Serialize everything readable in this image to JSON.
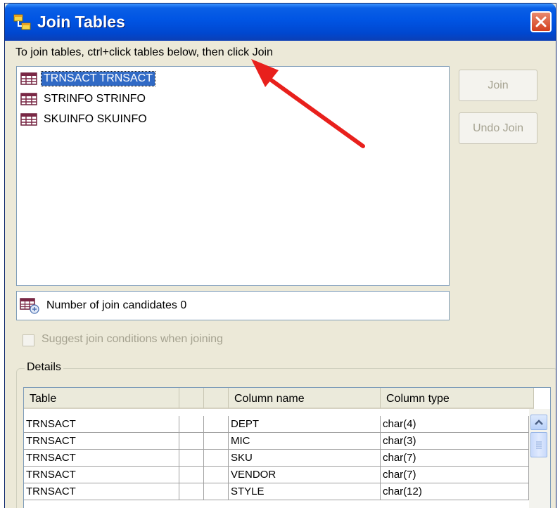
{
  "window": {
    "title": "Join Tables",
    "instruction": "To join tables, ctrl+click tables below, then click Join"
  },
  "tables": [
    {
      "label": "TRNSACT TRNSACT",
      "selected": true
    },
    {
      "label": "STRINFO STRINFO",
      "selected": false
    },
    {
      "label": "SKUINFO SKUINFO",
      "selected": false
    }
  ],
  "buttons": {
    "join": "Join",
    "undo_join": "Undo Join"
  },
  "candidates": {
    "label": "Number of join candidates 0"
  },
  "suggest": {
    "label": "Suggest join conditions when joining",
    "checked": false,
    "enabled": false
  },
  "details": {
    "legend": "Details",
    "columns": [
      "Table",
      "",
      "",
      "Column name",
      "Column type"
    ],
    "rows": [
      [
        "TRNSACT",
        "",
        "",
        "DEPT",
        "char(4)"
      ],
      [
        "TRNSACT",
        "",
        "",
        "MIC",
        "char(3)"
      ],
      [
        "TRNSACT",
        "",
        "",
        "SKU",
        "char(7)"
      ],
      [
        "TRNSACT",
        "",
        "",
        "VENDOR",
        "char(7)"
      ],
      [
        "TRNSACT",
        "",
        "",
        "STYLE",
        "char(12)"
      ]
    ]
  },
  "colors": {
    "selection": "#316ac5",
    "annotation_arrow": "#e8201c",
    "close_button": "#d64b2c"
  }
}
